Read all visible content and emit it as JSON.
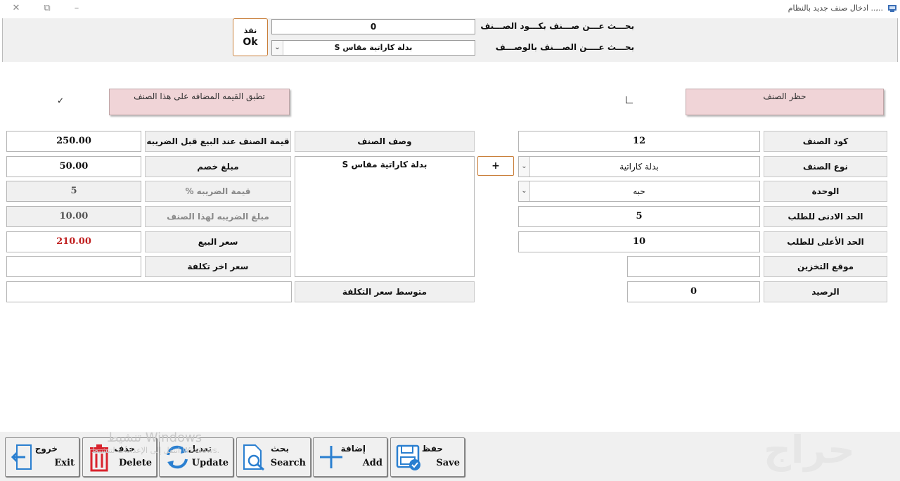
{
  "window": {
    "title": "..,.. ادخال صنف جديد بالنظام"
  },
  "search": {
    "by_code_label": "بحـــث عـــن صـــنف بكـــود الصـــنف",
    "by_code_value": "0",
    "by_desc_label": "بحـــث عــــن الصـــنف بالوصـــف",
    "by_desc_value": "بدلة كاراتية مقاس S",
    "ok_ar": "نفذ",
    "ok_en": "Ok"
  },
  "flags": {
    "block_label": "حظر الصنف",
    "block_checked": "",
    "vat_label": "تطبق القيمه المضافه على هذا الصنف",
    "vat_checked": "✓"
  },
  "item": {
    "code_label": "كود الصنف",
    "code_value": "12",
    "type_label": "نوع الصنف",
    "type_value": "بدلة كاراتية",
    "unit_label": "الوحدة",
    "unit_value": "حبه",
    "min_label": "الحد الادنى للطلب",
    "min_value": "5",
    "max_label": "الحد الأعلى للطلب",
    "max_value": "10",
    "location_label": "موقع التخزين",
    "location_value": "",
    "balance_label": "الرصيد",
    "balance_value": "0",
    "plus_label": "+",
    "desc_label": "وصف الصنف",
    "desc_value": "بدلة كاراتية مقاس S",
    "avg_cost_label": "متوسط سعر التكلفة",
    "avg_cost_value": ""
  },
  "pricing": {
    "price_before_tax_label": "قيمة الصنف عند البيع قبل الضريبه",
    "price_before_tax_value": "250.00",
    "discount_label": "مبلغ خصم",
    "discount_value": "50.00",
    "tax_pct_label": "قيمة الضريبه %",
    "tax_pct_value": "5",
    "tax_amount_label": "مبلغ الضريبه لهذا الصنف",
    "tax_amount_value": "10.00",
    "sale_price_label": "سعر البيع",
    "sale_price_value": "210.00",
    "last_cost_label": "سعر اخر تكلفة",
    "last_cost_value": ""
  },
  "toolbar": {
    "exit_ar": "خروج",
    "exit_en": "Exit",
    "delete_ar": "حذف",
    "delete_en": "Delete",
    "update_ar": "تعديل",
    "update_en": "Update",
    "search_ar": "بحث",
    "search_en": "Search",
    "add_ar": "إضافة",
    "add_en": "Add",
    "save_ar": "حفظ",
    "save_en": "Save"
  },
  "overlay": {
    "activation_title": "تنشيط Windows",
    "activation_sub": "انتقل إلى الإعدادات لتنشيط Windows.",
    "logo_text": "حراج"
  },
  "colors": {
    "accent_orange": "#c97f3a",
    "pink_panel": "#f0d4d7",
    "sale_red": "#c02020"
  }
}
